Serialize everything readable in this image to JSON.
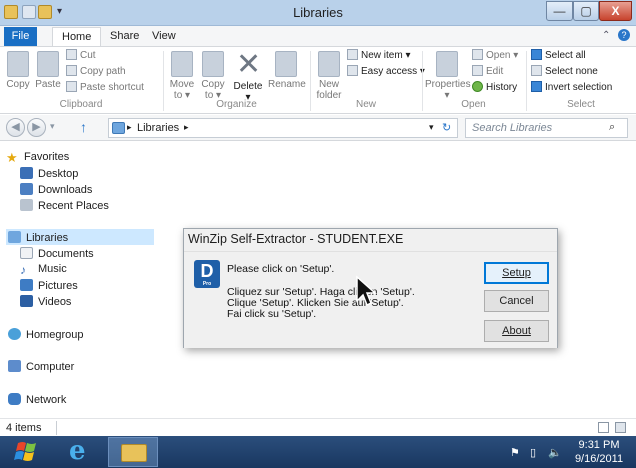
{
  "window": {
    "title": "Libraries",
    "minimize_glyph": "—",
    "maximize_glyph": "▢",
    "close_glyph": "X"
  },
  "ribbon_tabs": [
    "File",
    "Home",
    "Share",
    "View"
  ],
  "ribbon": {
    "clipboard": {
      "copy": "Copy",
      "paste": "Paste",
      "cut": "Cut",
      "copy_path": "Copy path",
      "paste_shortcut": "Paste shortcut",
      "group": "Clipboard"
    },
    "organize": {
      "move_to": "Move",
      "move_to_2": "to ▾",
      "copy_to": "Copy",
      "copy_to_2": "to ▾",
      "delete": "Delete",
      "delete_2": "▾",
      "rename": "Rename",
      "group": "Organize"
    },
    "new": {
      "new_folder": "New",
      "new_folder_2": "folder",
      "new_item": "New item ▾",
      "easy_access": "Easy access ▾",
      "group": "New"
    },
    "open": {
      "properties": "Properties",
      "properties_2": "▾",
      "open": "Open ▾",
      "edit": "Edit",
      "history": "History",
      "group": "Open"
    },
    "select": {
      "select_all": "Select all",
      "select_none": "Select none",
      "invert_selection": "Invert selection",
      "group": "Select"
    }
  },
  "address": {
    "path": "Libraries",
    "search_placeholder": "Search Libraries"
  },
  "nav_pane": {
    "favorites": "Favorites",
    "desktop": "Desktop",
    "downloads": "Downloads",
    "recent_places": "Recent Places",
    "libraries": "Libraries",
    "documents": "Documents",
    "music": "Music",
    "pictures": "Pictures",
    "videos": "Videos",
    "homegroup": "Homegroup",
    "computer": "Computer",
    "network": "Network"
  },
  "status": {
    "items": "4 items"
  },
  "dialog": {
    "title": "WinZip Self-Extractor - STUDENT.EXE",
    "icon_letter": "D",
    "icon_caption": "Pro",
    "line1": "Please click on 'Setup'.",
    "line2": "Cliquez sur 'Setup'.  Haga clic en 'Setup'.",
    "line3": "Clique 'Setup'.  Klicken Sie auf 'Setup'.",
    "line4": "Fai click su 'Setup'.",
    "setup": "Setup",
    "cancel": "Cancel",
    "about": "About"
  },
  "taskbar": {
    "time": "9:31 PM",
    "date": "9/16/2011"
  }
}
